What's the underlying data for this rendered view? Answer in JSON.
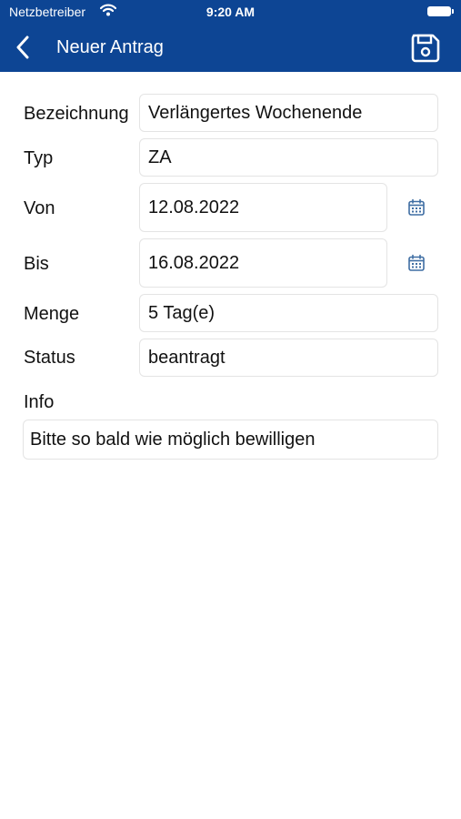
{
  "status_bar": {
    "carrier": "Netzbetreiber",
    "time": "9:20 AM"
  },
  "nav": {
    "title": "Neuer Antrag",
    "back_icon": "chevron-left-icon",
    "save_icon": "floppy-disk-icon"
  },
  "form": {
    "bezeichnung": {
      "label": "Bezeichnung",
      "value": "Verlängertes Wochenende"
    },
    "typ": {
      "label": "Typ",
      "value": "ZA"
    },
    "von": {
      "label": "Von",
      "value": "12.08.2022"
    },
    "bis": {
      "label": "Bis",
      "value": "16.08.2022"
    },
    "menge": {
      "label": "Menge",
      "value": "5 Tag(e)"
    },
    "status": {
      "label": "Status",
      "value": "beantragt"
    },
    "info": {
      "label": "Info",
      "value": "Bitte so bald wie möglich bewilligen"
    }
  },
  "colors": {
    "header": "#0d4594",
    "calendar_icon": "#3f6ea3"
  }
}
